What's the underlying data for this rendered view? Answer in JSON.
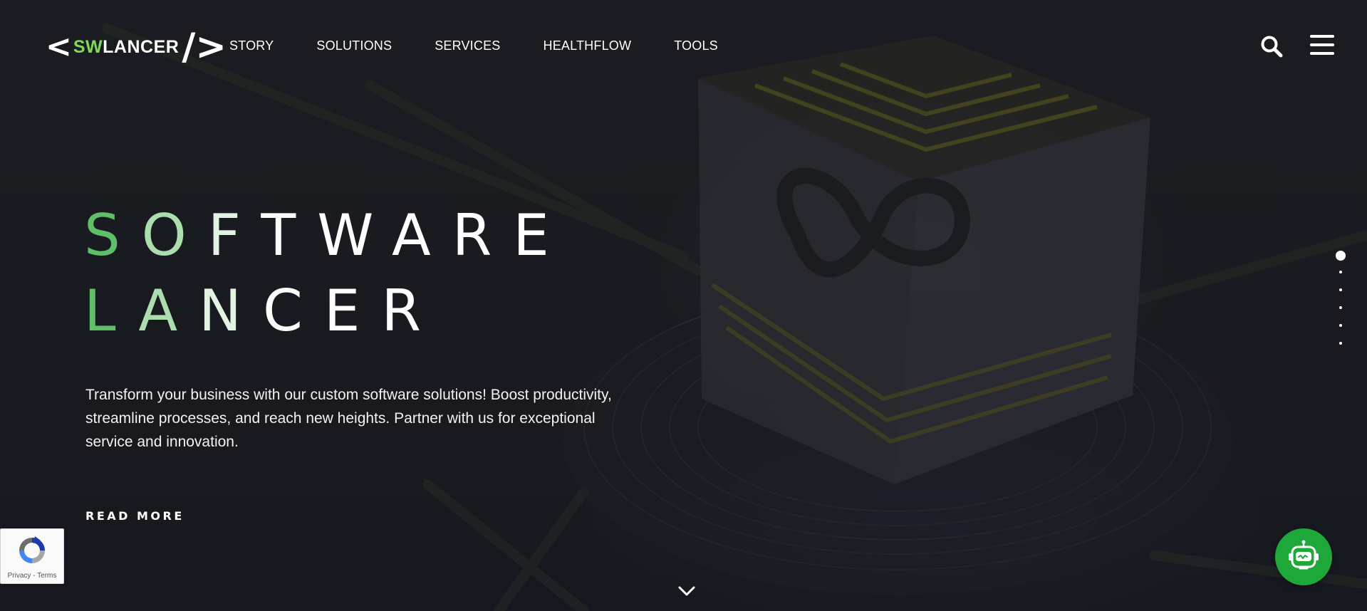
{
  "brand": {
    "logo_left_bracket": "<",
    "logo_sw": "SW",
    "logo_rest": "LANCER",
    "logo_slash_bracket": "/>",
    "accent_color": "#7ed957"
  },
  "nav": {
    "items": [
      {
        "label": "STORY"
      },
      {
        "label": "SOLUTIONS"
      },
      {
        "label": "SERVICES"
      },
      {
        "label": "HEALTHFLOW"
      },
      {
        "label": "TOOLS"
      }
    ]
  },
  "header_icons": {
    "search": "search-icon",
    "menu": "hamburger-menu-icon"
  },
  "hero": {
    "title_line1": "SOFTWARE",
    "title_line2": "LANCER",
    "gradient_colors": [
      "#5fbf68",
      "#d9efd9",
      "#ffffff"
    ],
    "description": "Transform your business with our custom software solutions! Boost productivity, streamline processes, and reach new heights. Partner with us for exceptional service and innovation.",
    "cta_label": "READ MORE"
  },
  "pager": {
    "total_slides": 6,
    "active_index": 0
  },
  "scroll_down_icon": "chevron-down-icon",
  "recaptcha": {
    "privacy": "Privacy",
    "separator": " - ",
    "terms": "Terms"
  },
  "chatbot": {
    "icon": "robot-icon",
    "color": "#1fa83a"
  }
}
